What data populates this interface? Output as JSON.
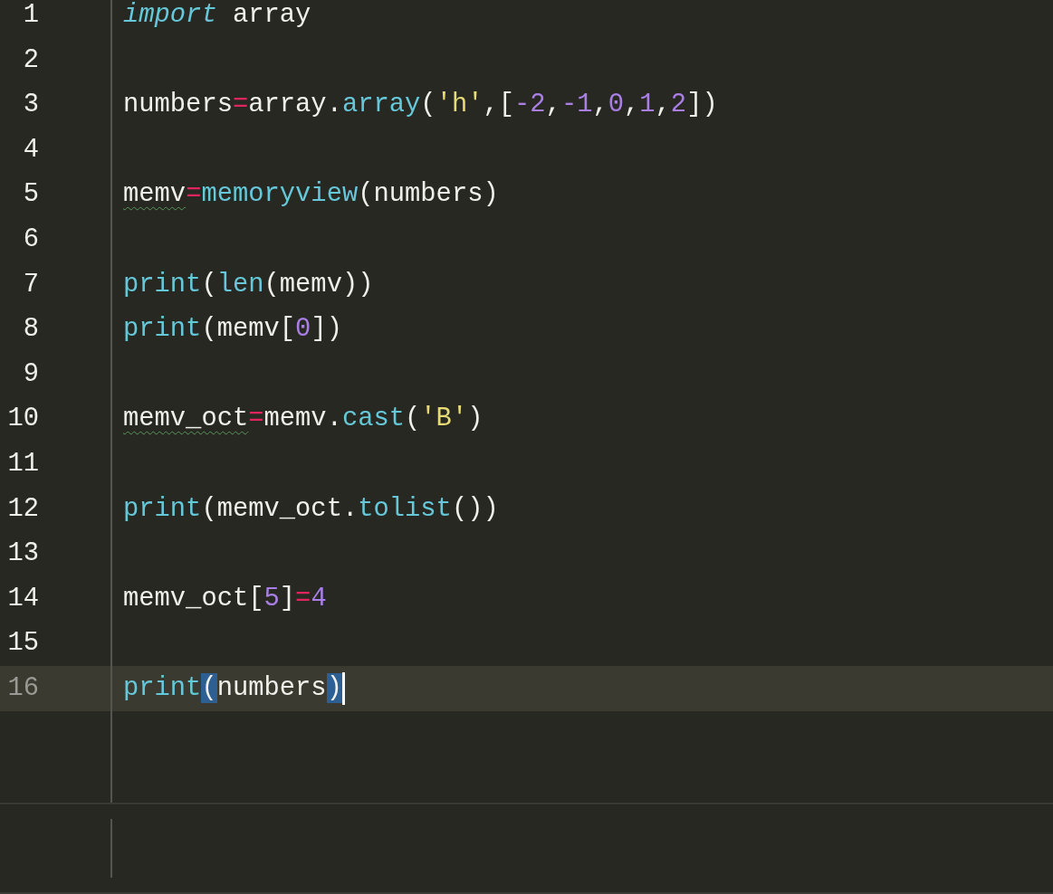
{
  "editor": {
    "lines": [
      {
        "number": "1",
        "current": false,
        "tokens": [
          {
            "kind": "keyword",
            "text": "import"
          },
          {
            "kind": "plain",
            "text": " array"
          }
        ]
      },
      {
        "number": "2",
        "current": false
      },
      {
        "number": "3",
        "current": false,
        "tokens": [
          {
            "kind": "plain",
            "text": "numbers"
          },
          {
            "kind": "operator",
            "text": "="
          },
          {
            "kind": "plain",
            "text": "array."
          },
          {
            "kind": "function",
            "text": "array"
          },
          {
            "kind": "plain",
            "text": "("
          },
          {
            "kind": "string",
            "text": "'h'"
          },
          {
            "kind": "plain",
            "text": ",["
          },
          {
            "kind": "number",
            "text": "-2"
          },
          {
            "kind": "plain",
            "text": ","
          },
          {
            "kind": "number",
            "text": "-1"
          },
          {
            "kind": "plain",
            "text": ","
          },
          {
            "kind": "number",
            "text": "0"
          },
          {
            "kind": "plain",
            "text": ","
          },
          {
            "kind": "number",
            "text": "1"
          },
          {
            "kind": "plain",
            "text": ","
          },
          {
            "kind": "number",
            "text": "2"
          },
          {
            "kind": "plain",
            "text": "])"
          }
        ]
      },
      {
        "number": "4",
        "current": false
      },
      {
        "number": "5",
        "current": false,
        "tokens": [
          {
            "kind": "plain",
            "text": "memv",
            "warning": true
          },
          {
            "kind": "operator",
            "text": "="
          },
          {
            "kind": "function",
            "text": "memoryview"
          },
          {
            "kind": "plain",
            "text": "(numbers)"
          }
        ]
      },
      {
        "number": "6",
        "current": false
      },
      {
        "number": "7",
        "current": false,
        "tokens": [
          {
            "kind": "function",
            "text": "print"
          },
          {
            "kind": "plain",
            "text": "("
          },
          {
            "kind": "function",
            "text": "len"
          },
          {
            "kind": "plain",
            "text": "(memv))"
          }
        ]
      },
      {
        "number": "8",
        "current": false,
        "tokens": [
          {
            "kind": "function",
            "text": "print"
          },
          {
            "kind": "plain",
            "text": "(memv["
          },
          {
            "kind": "number",
            "text": "0"
          },
          {
            "kind": "plain",
            "text": "])"
          }
        ]
      },
      {
        "number": "9",
        "current": false
      },
      {
        "number": "10",
        "current": false,
        "tokens": [
          {
            "kind": "plain",
            "text": "memv_oct",
            "warning": true
          },
          {
            "kind": "operator",
            "text": "="
          },
          {
            "kind": "plain",
            "text": "memv."
          },
          {
            "kind": "function",
            "text": "cast"
          },
          {
            "kind": "plain",
            "text": "("
          },
          {
            "kind": "string",
            "text": "'B'"
          },
          {
            "kind": "plain",
            "text": ")"
          }
        ]
      },
      {
        "number": "11",
        "current": false
      },
      {
        "number": "12",
        "current": false,
        "tokens": [
          {
            "kind": "function",
            "text": "print"
          },
          {
            "kind": "plain",
            "text": "(memv_oct."
          },
          {
            "kind": "function",
            "text": "tolist"
          },
          {
            "kind": "plain",
            "text": "())"
          }
        ]
      },
      {
        "number": "13",
        "current": false
      },
      {
        "number": "14",
        "current": false,
        "tokens": [
          {
            "kind": "plain",
            "text": "memv_oct["
          },
          {
            "kind": "number",
            "text": "5"
          },
          {
            "kind": "plain",
            "text": "]"
          },
          {
            "kind": "operator",
            "text": "="
          },
          {
            "kind": "number",
            "text": "4"
          }
        ]
      },
      {
        "number": "15",
        "current": false
      },
      {
        "number": "16",
        "current": true,
        "caret": true,
        "tokens": [
          {
            "kind": "function",
            "text": "print"
          },
          {
            "kind": "plain",
            "text": "(",
            "matched": true
          },
          {
            "kind": "plain",
            "text": "numbers"
          },
          {
            "kind": "plain",
            "text": ")",
            "matched": true
          }
        ]
      }
    ]
  }
}
